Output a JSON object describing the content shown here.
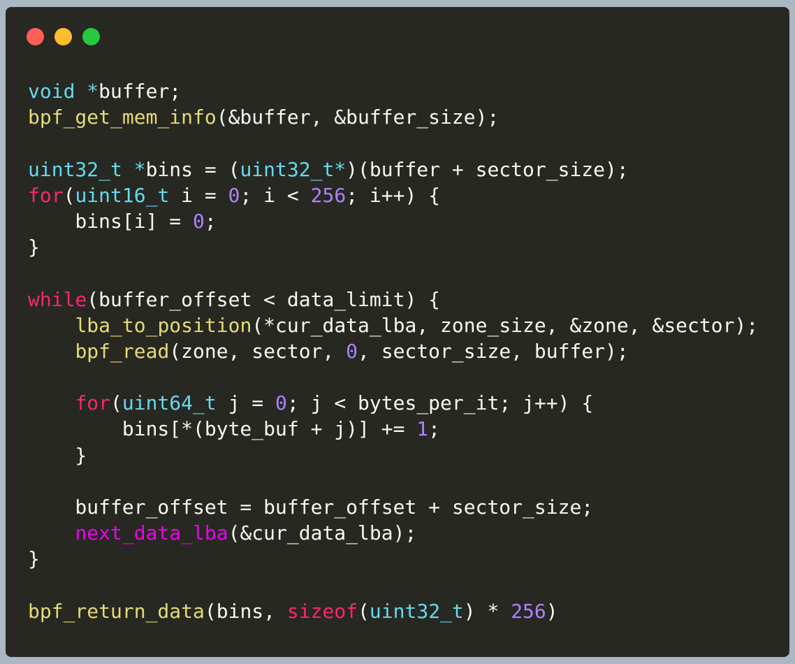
{
  "window": {
    "controls": [
      {
        "name": "close",
        "color": "#ff5f56"
      },
      {
        "name": "minimize",
        "color": "#ffbd2e"
      },
      {
        "name": "maximize",
        "color": "#27c93f"
      }
    ]
  },
  "colors": {
    "background": "#abb8c3",
    "editor_background": "#272822",
    "plain": "#f8f8f2",
    "type": "#66d9ef",
    "function": "#e6db74",
    "keyword": "#f92672",
    "number": "#ae81ff",
    "macro": "#ee00ee"
  },
  "code": {
    "language": "c",
    "lines": [
      [
        {
          "t": "void",
          "k": "type"
        },
        {
          "t": " ",
          "k": "plain"
        },
        {
          "t": "*",
          "k": "type"
        },
        {
          "t": "buffer;",
          "k": "plain"
        }
      ],
      [
        {
          "t": "bpf_get_mem_info",
          "k": "function"
        },
        {
          "t": "(&buffer, &buffer_size);",
          "k": "plain"
        }
      ],
      [],
      [
        {
          "t": "uint32_t",
          "k": "type"
        },
        {
          "t": " ",
          "k": "plain"
        },
        {
          "t": "*",
          "k": "type"
        },
        {
          "t": "bins = (",
          "k": "plain"
        },
        {
          "t": "uint32_t*",
          "k": "type"
        },
        {
          "t": ")(buffer + sector_size);",
          "k": "plain"
        }
      ],
      [
        {
          "t": "for",
          "k": "keyword"
        },
        {
          "t": "(",
          "k": "plain"
        },
        {
          "t": "uint16_t",
          "k": "type"
        },
        {
          "t": " i = ",
          "k": "plain"
        },
        {
          "t": "0",
          "k": "number"
        },
        {
          "t": "; i < ",
          "k": "plain"
        },
        {
          "t": "256",
          "k": "number"
        },
        {
          "t": "; i++) {",
          "k": "plain"
        }
      ],
      [
        {
          "t": "    bins[i] = ",
          "k": "plain"
        },
        {
          "t": "0",
          "k": "number"
        },
        {
          "t": ";",
          "k": "plain"
        }
      ],
      [
        {
          "t": "}",
          "k": "plain"
        }
      ],
      [],
      [
        {
          "t": "while",
          "k": "keyword"
        },
        {
          "t": "(buffer_offset < data_limit) {",
          "k": "plain"
        }
      ],
      [
        {
          "t": "    ",
          "k": "plain"
        },
        {
          "t": "lba_to_position",
          "k": "function"
        },
        {
          "t": "(*cur_data_lba, zone_size, &zone, &sector);",
          "k": "plain"
        }
      ],
      [
        {
          "t": "    ",
          "k": "plain"
        },
        {
          "t": "bpf_read",
          "k": "function"
        },
        {
          "t": "(zone, sector, ",
          "k": "plain"
        },
        {
          "t": "0",
          "k": "number"
        },
        {
          "t": ", sector_size, buffer);",
          "k": "plain"
        }
      ],
      [],
      [
        {
          "t": "    ",
          "k": "plain"
        },
        {
          "t": "for",
          "k": "keyword"
        },
        {
          "t": "(",
          "k": "plain"
        },
        {
          "t": "uint64_t",
          "k": "type"
        },
        {
          "t": " j = ",
          "k": "plain"
        },
        {
          "t": "0",
          "k": "number"
        },
        {
          "t": "; j < bytes_per_it; j++) {",
          "k": "plain"
        }
      ],
      [
        {
          "t": "        bins[*(byte_buf + j)] += ",
          "k": "plain"
        },
        {
          "t": "1",
          "k": "number"
        },
        {
          "t": ";",
          "k": "plain"
        }
      ],
      [
        {
          "t": "    }",
          "k": "plain"
        }
      ],
      [],
      [
        {
          "t": "    buffer_offset = buffer_offset + sector_size;",
          "k": "plain"
        }
      ],
      [
        {
          "t": "    ",
          "k": "plain"
        },
        {
          "t": "next_data_lba",
          "k": "macro"
        },
        {
          "t": "(&cur_data_lba);",
          "k": "plain"
        }
      ],
      [
        {
          "t": "}",
          "k": "plain"
        }
      ],
      [],
      [
        {
          "t": "bpf_return_data",
          "k": "function"
        },
        {
          "t": "(bins, ",
          "k": "plain"
        },
        {
          "t": "sizeof",
          "k": "keyword"
        },
        {
          "t": "(",
          "k": "plain"
        },
        {
          "t": "uint32_t",
          "k": "type"
        },
        {
          "t": ") * ",
          "k": "plain"
        },
        {
          "t": "256",
          "k": "number"
        },
        {
          "t": ")",
          "k": "plain"
        }
      ]
    ]
  }
}
